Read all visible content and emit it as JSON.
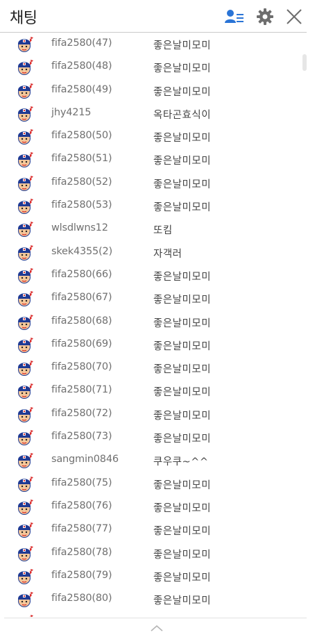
{
  "header": {
    "title": "채팅",
    "icons": [
      "users-icon",
      "gear-icon",
      "close-icon"
    ]
  },
  "colors": {
    "accent": "#2a74d6",
    "icon_gray": "#6e6e6e",
    "avatar_navy": "#1f3a93",
    "avatar_red": "#d92b2b",
    "avatar_skin": "#f4c79a"
  },
  "messages": [
    {
      "user": "fifa2580(47)",
      "text": "좋은날미모미"
    },
    {
      "user": "fifa2580(48)",
      "text": "좋은날미모미"
    },
    {
      "user": "fifa2580(49)",
      "text": "좋은날미모미"
    },
    {
      "user": "jhy4215",
      "text": "옥타곤효식이"
    },
    {
      "user": "fifa2580(50)",
      "text": "좋은날미모미"
    },
    {
      "user": "fifa2580(51)",
      "text": "좋은날미모미"
    },
    {
      "user": "fifa2580(52)",
      "text": "좋은날미모미"
    },
    {
      "user": "fifa2580(53)",
      "text": "좋은날미모미"
    },
    {
      "user": "wlsdlwns12",
      "text": "또킴"
    },
    {
      "user": "skek4355(2)",
      "text": "자객러"
    },
    {
      "user": "fifa2580(66)",
      "text": "좋은날미모미"
    },
    {
      "user": "fifa2580(67)",
      "text": "좋은날미모미"
    },
    {
      "user": "fifa2580(68)",
      "text": "좋은날미모미"
    },
    {
      "user": "fifa2580(69)",
      "text": "좋은날미모미"
    },
    {
      "user": "fifa2580(70)",
      "text": "좋은날미모미"
    },
    {
      "user": "fifa2580(71)",
      "text": "좋은날미모미"
    },
    {
      "user": "fifa2580(72)",
      "text": "좋은날미모미"
    },
    {
      "user": "fifa2580(73)",
      "text": "좋은날미모미"
    },
    {
      "user": "sangmin0846",
      "text": "쿠우쿠~^^"
    },
    {
      "user": "fifa2580(75)",
      "text": "좋은날미모미"
    },
    {
      "user": "fifa2580(76)",
      "text": "좋은날미모미"
    },
    {
      "user": "fifa2580(77)",
      "text": "좋은날미모미"
    },
    {
      "user": "fifa2580(78)",
      "text": "좋은날미모미"
    },
    {
      "user": "fifa2580(79)",
      "text": "좋은날미모미"
    },
    {
      "user": "fifa2580(80)",
      "text": "좋은날미모미"
    },
    {
      "user": "",
      "text": ""
    }
  ],
  "footer": {
    "icon": "chevron-up-icon"
  }
}
